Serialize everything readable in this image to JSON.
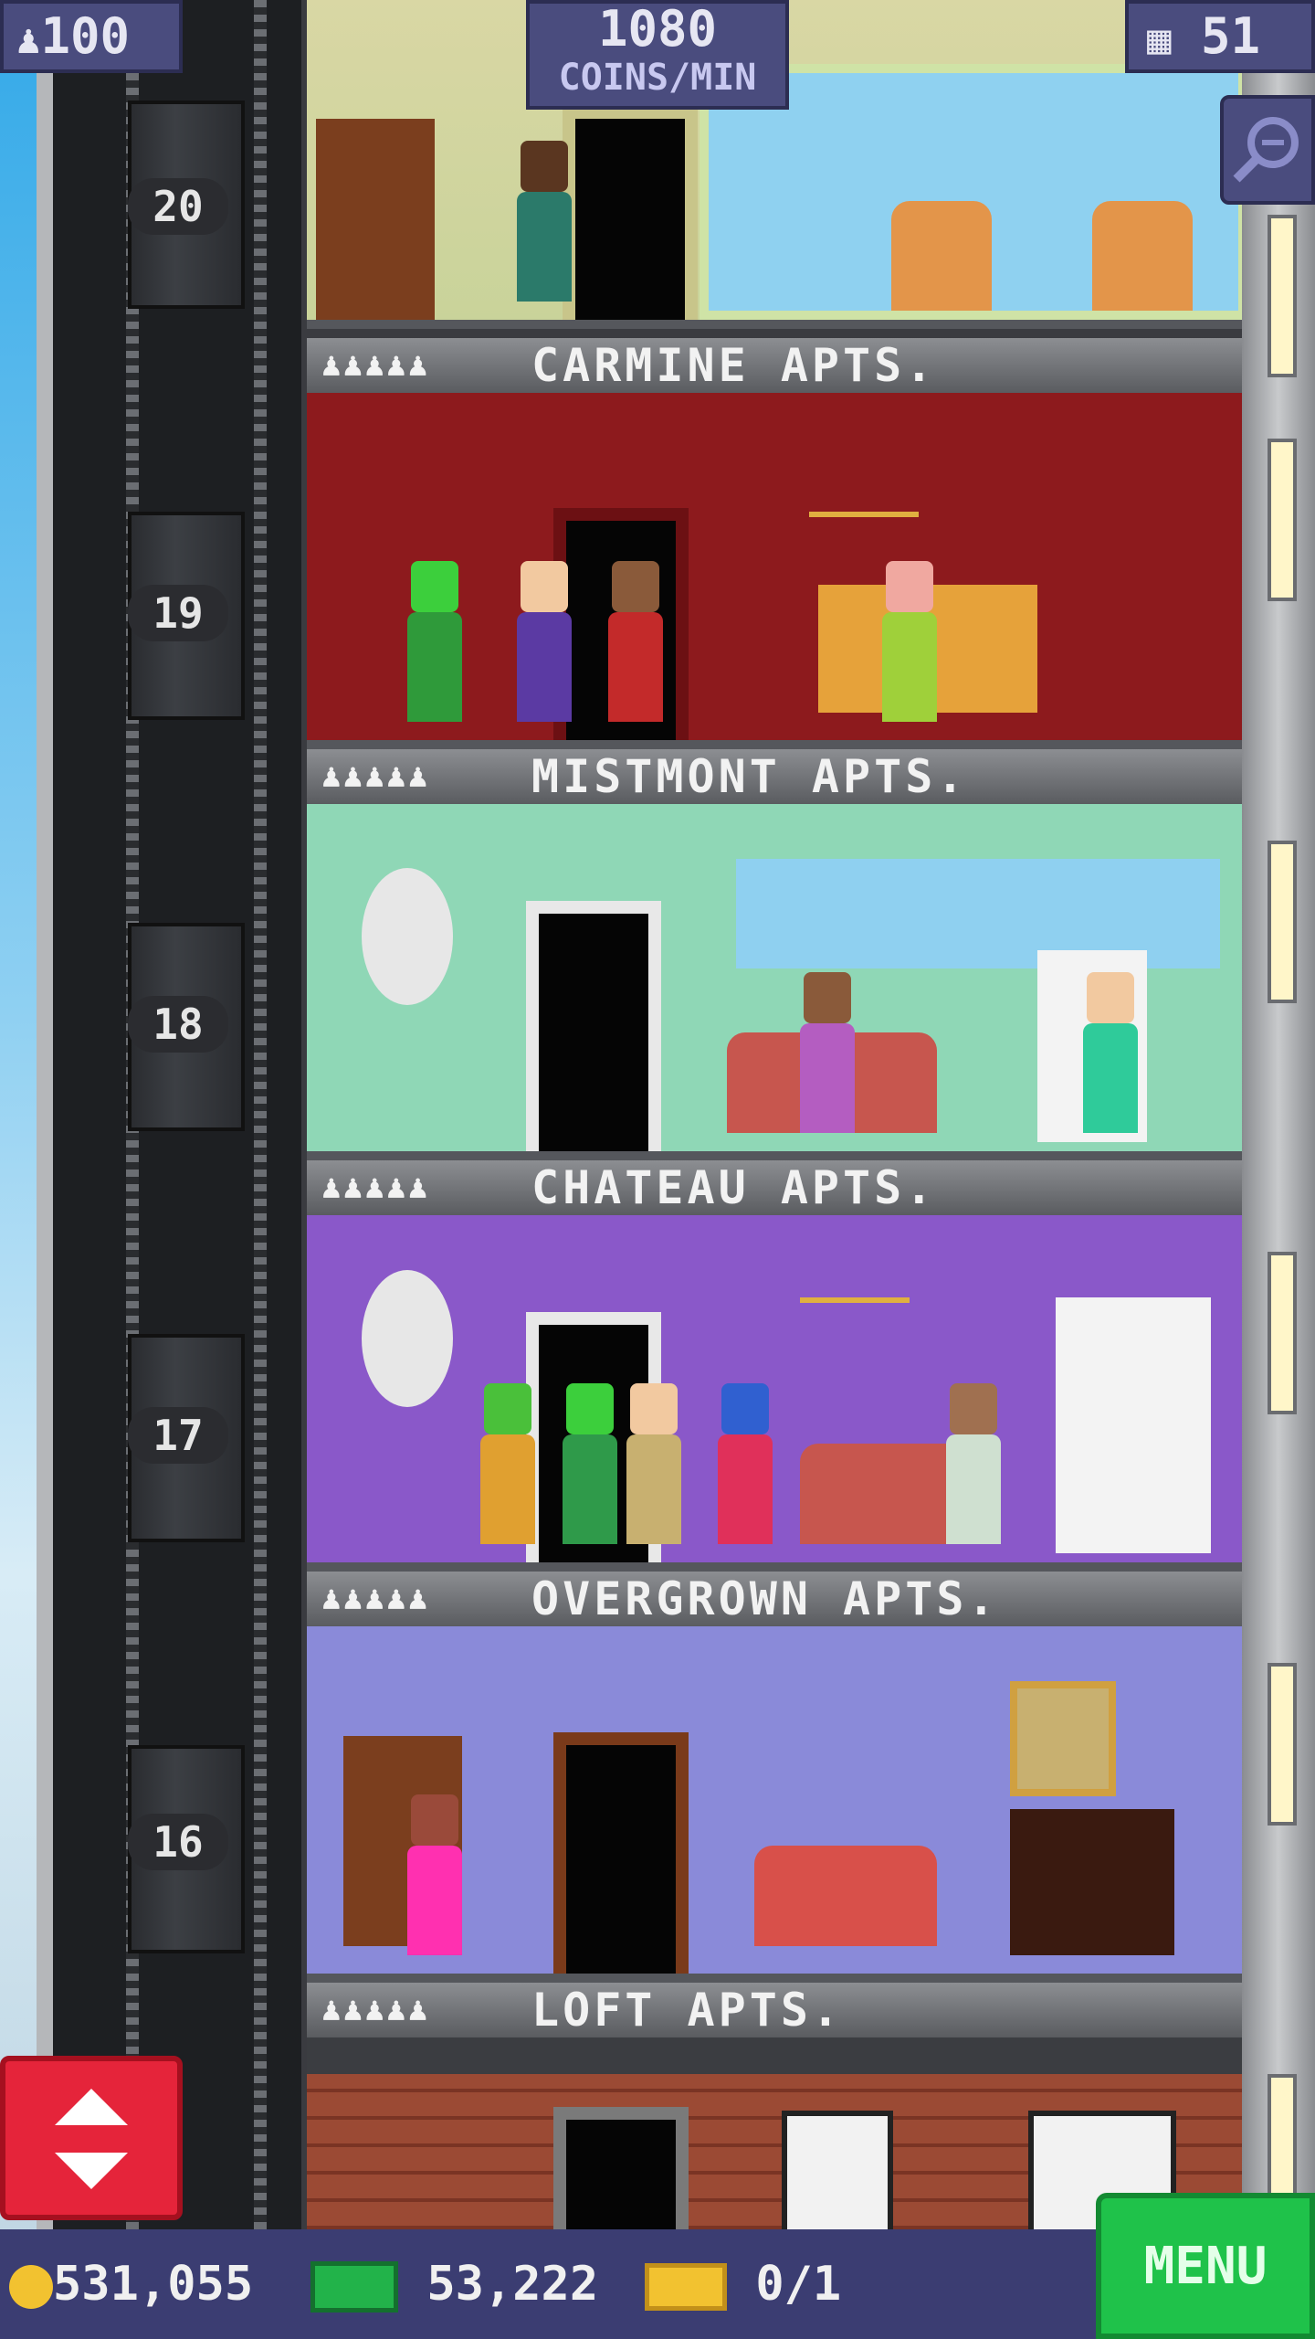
{
  "hud": {
    "population": "100",
    "coins_rate_value": "1080",
    "coins_rate_unit": "COINS/MIN",
    "floors_count": "51"
  },
  "floors": [
    {
      "number": "20",
      "name": "",
      "theme": "#b8d6a8"
    },
    {
      "number": "19",
      "name": "CARMINE APTS.",
      "theme": "#8d1a1d"
    },
    {
      "number": "18",
      "name": "MISTMONT APTS.",
      "theme": "#8fd7b6"
    },
    {
      "number": "17",
      "name": "CHATEAU APTS.",
      "theme": "#8a58c9"
    },
    {
      "number": "16",
      "name": "OVERGROWN APTS.",
      "theme": "#8a8ad9"
    },
    {
      "number": "",
      "name": "LOFT APTS.",
      "theme": "#9b4a34"
    }
  ],
  "residents_icon": "♟♟♟♟♟",
  "bottom": {
    "coins": "531,055",
    "bux": "53,222",
    "tickets": "0/1",
    "menu_label": "MENU"
  },
  "icons": {
    "population": "person-icon",
    "floors": "building-icon",
    "zoom": "magnifier-icon",
    "elevator": "up-down-arrows-icon",
    "coin": "coin-icon",
    "bux": "bux-icon",
    "ticket": "ticket-icon"
  }
}
